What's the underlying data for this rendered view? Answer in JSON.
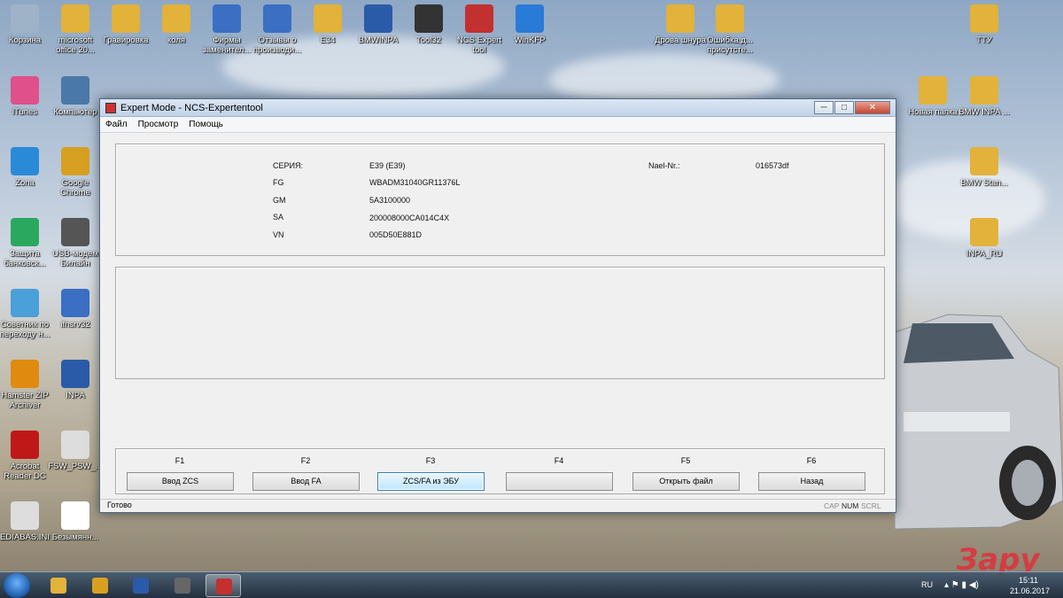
{
  "desktop": {
    "icons": [
      {
        "label": "Корзина",
        "color": "#9fb3c8"
      },
      {
        "label": "microsoft office 20...",
        "color": "#e2b23a"
      },
      {
        "label": "Гравировка",
        "color": "#e2b23a"
      },
      {
        "label": "коля",
        "color": "#e2b23a"
      },
      {
        "label": "Фирмы заменител...",
        "color": "#3a6fc4"
      },
      {
        "label": "Отзывы о производи...",
        "color": "#3a6fc4"
      },
      {
        "label": "E34",
        "color": "#e2b23a"
      },
      {
        "label": "BMWINPA",
        "color": "#2a5ba8"
      },
      {
        "label": "Tool32",
        "color": "#333333"
      },
      {
        "label": "NCS Expert tool",
        "color": "#c33030"
      },
      {
        "label": "WinKFP",
        "color": "#2a7ad8"
      },
      {
        "label": "Дрова шнура",
        "color": "#e2b23a"
      },
      {
        "label": "Ошибка,д... присутсте...",
        "color": "#e2b23a"
      },
      {
        "label": "ТТУ",
        "color": "#e2b23a"
      },
      {
        "label": "iTunes",
        "color": "#e0508a"
      },
      {
        "label": "Компьютер",
        "color": "#4a78a8"
      },
      {
        "label": "Новая папка",
        "color": "#e2b23a"
      },
      {
        "label": "BMW INPA ...",
        "color": "#e2b23a"
      },
      {
        "label": "Zona",
        "color": "#2a8ad8"
      },
      {
        "label": "Google Chrome",
        "color": "#d8a020"
      },
      {
        "label": "BMW Stan...",
        "color": "#e2b23a"
      },
      {
        "label": "Защита банковск...",
        "color": "#2aa860"
      },
      {
        "label": "USB-модем Билайн",
        "color": "#555555"
      },
      {
        "label": "INPA_RU",
        "color": "#e2b23a"
      },
      {
        "label": "Советник по переходу н...",
        "color": "#4aa0d8"
      },
      {
        "label": "ifhsrv32",
        "color": "#3a6fc4"
      },
      {
        "label": "Hamster ZIP Archiver",
        "color": "#e08a10"
      },
      {
        "label": "INPA",
        "color": "#2a5ba8"
      },
      {
        "label": "Acrobat Reader DC",
        "color": "#c01818"
      },
      {
        "label": "FSW_PSW_...",
        "color": "#dddddd"
      },
      {
        "label": "EDIABAS.INI",
        "color": "#dddddd"
      },
      {
        "label": "Безымянн...",
        "color": "#ffffff"
      }
    ]
  },
  "window": {
    "title": "Expert Mode - NCS-Expertentool",
    "controls": {
      "minimize": "─",
      "maximize": "□",
      "close": "✕"
    },
    "menu": [
      "Файл",
      "Просмотр",
      "Помощь"
    ],
    "info": {
      "series_label": "СЕРИЯ:",
      "series_value": "E39 (E39)",
      "fg_label": "FG",
      "fg_value": "WBADM31040GR11376L",
      "gm_label": "GM",
      "gm_value": "5A3100000",
      "sa_label": "SA",
      "sa_value": "200008000CA014C4X",
      "vn_label": "VN",
      "vn_value": "005D50E881D",
      "nael_label": "Nael-Nr.:",
      "nael_value": "016573df"
    },
    "fkeys": [
      {
        "key": "F1",
        "label": "Ввод ZCS",
        "active": false
      },
      {
        "key": "F2",
        "label": "Ввод FA",
        "active": false
      },
      {
        "key": "F3",
        "label": "ZCS/FA из ЭБУ",
        "active": true
      },
      {
        "key": "F4",
        "label": "",
        "active": false
      },
      {
        "key": "F5",
        "label": "Открыть файл",
        "active": false
      },
      {
        "key": "F6",
        "label": "Назад",
        "active": false
      }
    ],
    "status": {
      "text": "Готово",
      "cap": "CAP",
      "num": "NUM",
      "scrl": "SCRL"
    }
  },
  "taskbar": {
    "apps": [
      {
        "name": "explorer",
        "color": "#e2b23a",
        "active": false
      },
      {
        "name": "chrome",
        "color": "#d8a020",
        "active": false
      },
      {
        "name": "bmw",
        "color": "#2a5ba8",
        "active": false
      },
      {
        "name": "ista",
        "color": "#666666",
        "active": false
      },
      {
        "name": "ncs-expert",
        "color": "#c33030",
        "active": true
      }
    ],
    "language": "RU",
    "time": "15:11",
    "date": "21.06.2017"
  }
}
